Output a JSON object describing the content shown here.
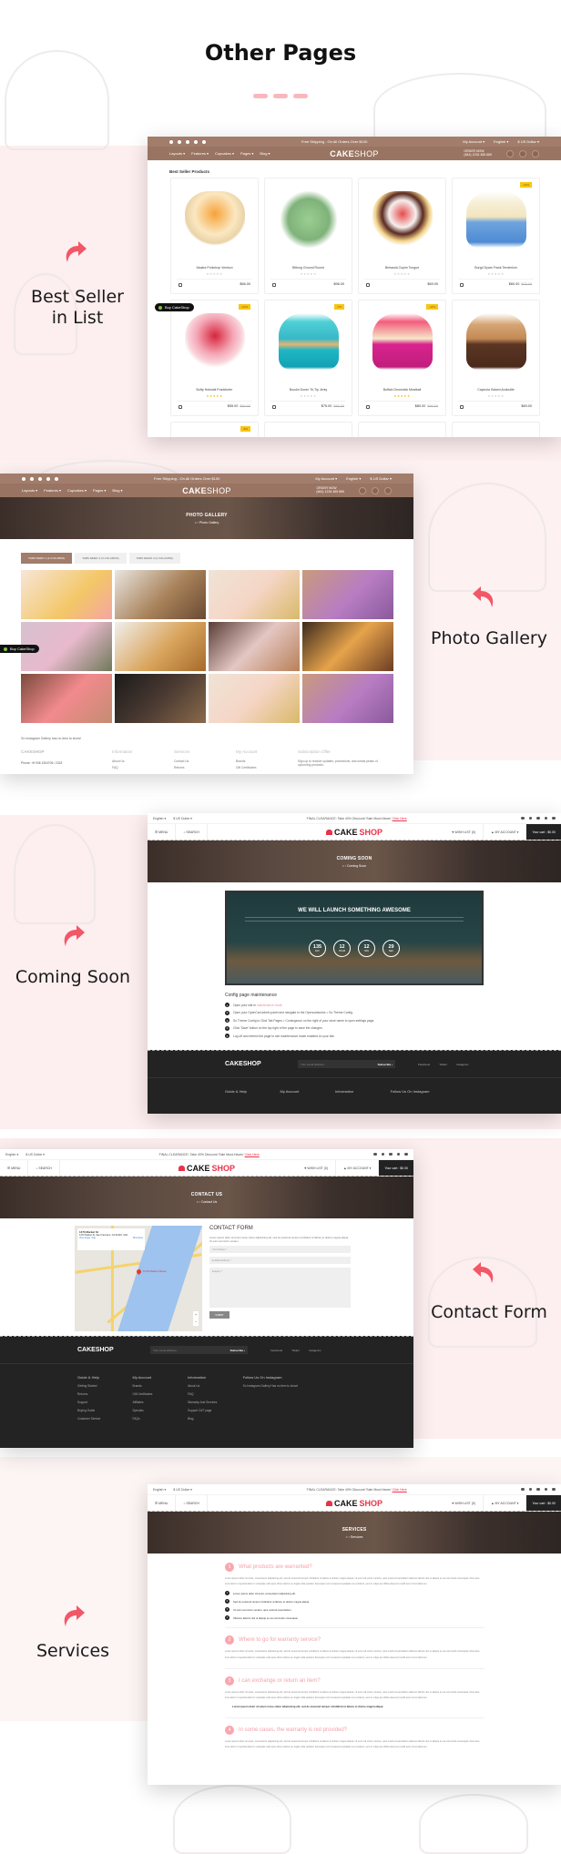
{
  "heading": "Other Pages",
  "labels": {
    "best_seller": "Best Seller\nin List",
    "best_seller_l1": "Best Seller",
    "best_seller_l2": "in List",
    "photo_gallery": "Photo Gallery",
    "coming_soon": "Coming Soon",
    "contact_form": "Contact Form",
    "services": "Services"
  },
  "icons": {
    "arrow": "curved-arrow-icon",
    "accent": "#f25767"
  },
  "brown_theme": {
    "top_bar_text": "Free Shipping - On All Orders Over $100",
    "my_account": "My Account ▾",
    "language": "English ▾",
    "currency": "$ US Dollar ▾",
    "nav": [
      "Layouts ▾",
      "Features ▾",
      "Cupcakes ▾",
      "Pages ▾",
      "Blog ▾"
    ],
    "logo_bold": "CAKE",
    "logo_thin": "SHOP",
    "order_label": "ORDER NOW",
    "phone": "(844) 1234 455 669",
    "cart_count": "0",
    "color": "#a27d6b"
  },
  "best_seller": {
    "title": "Best Seller Products",
    "badge": "Buy CakeShop",
    "products": [
      {
        "name": "Alcatra Porkchop Venison",
        "price": "$66.00",
        "old": "",
        "sale": "",
        "rated": false
      },
      {
        "name": "Biltong Ground Round",
        "price": "$96.00",
        "old": "",
        "sale": "",
        "rated": false
      },
      {
        "name": "Bresaola Cupim Tongue",
        "price": "$69.00",
        "old": "",
        "sale": "",
        "rated": false
      },
      {
        "name": "Burgd Dyam Frank Tenderloin",
        "price": "$60.00",
        "old": "$75.00",
        "sale": "-13%",
        "rated": false
      },
      {
        "name": "Boftp Hubwalt Frankfurter",
        "price": "$55.00",
        "old": "$60.00",
        "sale": "-10%",
        "rated": true
      },
      {
        "name": "Boudin Doner Tri-Tip Jerky",
        "price": "$75.00",
        "old": "$81.00",
        "sale": "-7%",
        "rated": false
      },
      {
        "name": "Buffalo Drumstick Meatball",
        "price": "$80.00",
        "old": "$90.00",
        "sale": "-11%",
        "rated": true
      },
      {
        "name": "Capicola Salami Andouille",
        "price": "$83.00",
        "old": "",
        "sale": "",
        "rated": false
      }
    ],
    "partial_row_sale": "-8%"
  },
  "photo_gallery": {
    "title": "PHOTO GALLERY",
    "breadcrumb": "Photo Gallery",
    "tabs": [
      "TABS DEMO 1 (4 COLUMNS)",
      "TABS DEMO 2 (3 COLUMNS)",
      "TABS DEMO 3 (2 COLUMNS)"
    ],
    "images": [
      "cupcakes-bear-toppers",
      "oat-cookies",
      "ice-cream-cup",
      "purple-smoothie-bowl",
      "pink-cafe-storefront",
      "apple-tart",
      "cupcake-display",
      "cake-slices-board",
      "pink-cupcakes-stand",
      "chocolate-bark",
      "ice-cream-cup",
      "purple-smoothie-bowl"
    ],
    "badge": "Buy CakeShop",
    "instagram_note": "So Instagram Gallery has no item to show!",
    "footer_logo": "CAKESHOP",
    "phone": "Phone: +8 936 1304705 / 2323",
    "columns": [
      {
        "title": "Information",
        "items": [
          "About Us",
          "FAQ"
        ]
      },
      {
        "title": "Services",
        "items": [
          "Contact Us",
          "Returns"
        ]
      },
      {
        "title": "My Account",
        "items": [
          "Brands",
          "Gift Certificates"
        ]
      }
    ],
    "subscription_title": "Subscription Offer",
    "subscription_text": "Sign up to receive updates, promotions, and sneak peaks of upcoming products."
  },
  "red_theme": {
    "language": "English ▾",
    "currency": "$ US Dollar ▾",
    "promo": "FINAL CLEARANCE: Take 40% Discount 'Sale Must-Haves'",
    "promo_link": "Click Here",
    "menu": "MENU",
    "search": "SEARCH",
    "logo_a": "CAKE",
    "logo_b": "SHOP",
    "wishlist": "WISH LIST (0)",
    "account": "MY ACCOUNT ▾",
    "cart": "Your cart : $0.00",
    "accent": "#e8334a"
  },
  "coming_soon": {
    "title": "COMING SOON",
    "breadcrumb": "Coming Soon",
    "headline": "WE WILL LAUNCH SOMETHING AWESOME",
    "countdown": [
      {
        "value": "135",
        "unit": "DAY"
      },
      {
        "value": "12",
        "unit": "HOUR"
      },
      {
        "value": "12",
        "unit": "MIN"
      },
      {
        "value": "29",
        "unit": "SEC"
      }
    ],
    "config_title": "Config page maintenance",
    "steps": [
      {
        "n": "1",
        "text": "Open your site in ",
        "link": "maintenance mode"
      },
      {
        "n": "2",
        "text": "Open your OpenCart admin panel and navigate to the Opencartworks > So Theme Config.",
        "link": ""
      },
      {
        "n": "3",
        "text": "So Theme Config to Click Tab Pages > Comingsoon on the right of your store name to open settings page.",
        "link": ""
      },
      {
        "n": "4",
        "text": "Click 'Save' button on the top right of the page to save the changes.",
        "link": ""
      },
      {
        "n": "5",
        "text": "Log off and refresh the page to see maintenance mode enabled on your site.",
        "link": ""
      }
    ]
  },
  "footer": {
    "logo": "CAKESHOP",
    "email_placeholder": "Your email address...",
    "subscribe": "Subscribe ›",
    "social": [
      "Facebook",
      "Twitter",
      "Instagram"
    ],
    "columns": [
      {
        "title": "Guide & Help",
        "items": [
          "Getting Started",
          "Returns",
          "Support",
          "Buying Guide",
          "Customer Service"
        ]
      },
      {
        "title": "My Account",
        "items": [
          "Brands",
          "Gift Certificates",
          "Affiliates",
          "Specials",
          "FAQs"
        ]
      },
      {
        "title": "Information",
        "items": [
          "About Us",
          "FAQ",
          "Warranty And Services",
          "Support 24/7 page",
          "Blog"
        ]
      },
      {
        "title": "Follow Us On Instagram",
        "items": [
          "So Instagram Gallery Has no item to show!"
        ]
      }
    ]
  },
  "contact": {
    "title": "CONTACT US",
    "breadcrumb": "Contact Us",
    "map_place": "1470 Market St",
    "map_address": "1470 Market St, San Francisco, CA 94103, USA",
    "map_directions": "Directions",
    "map_larger": "View larger map",
    "map_pin": "1470 Market Street",
    "form_title": "CONTACT FORM",
    "form_desc": "Lorem ipsum dolor sit amet conse ctetur adipisicing elit, sed do eiusmod tempor incididunt ut labore et dolore magna aliqua. Ut enim ad minim veniam.",
    "name_placeholder": "Your Name *",
    "email_placeholder": "E-Mail Address *",
    "enquiry_placeholder": "Enquiry *",
    "submit": "SUBMIT"
  },
  "services": {
    "title": "SERVICES",
    "breadcrumb": "Services",
    "faqs": [
      {
        "n": "1",
        "q": "What products are warranted?"
      },
      {
        "n": "2",
        "q": "Where to go for warranty service?"
      },
      {
        "n": "3",
        "q": "I can exchange or return an item?"
      },
      {
        "n": "4",
        "q": "In some cases, the warranty is not provided?"
      }
    ],
    "lorem": "Lorem ipsum dolor sit amet, consectetur adipisicing elit, sed do eiusmod tempor incididunt ut labore et dolore magna aliqua. Ut enim ad minim veniam, quis nostrud exercitation ullamco laboris nisi ut aliquip ex ea commodo consequat. Duis aute irure dolor in reprehenderit in voluptate velit esse cillum dolore eu fugiat nulla pariatur. Excepteur sint occaecat cupidatat non proident, sunt in culpa qui officia deserunt mollit anim id est laborum.",
    "list": [
      "Lorem ipsum dolor sit amet, consectetur adipisicing elit.",
      "Sed do eiusmod tempor incididunt ut labore et dolore magna aliqua.",
      "Ut enim ad minim veniam, quis nostrud exercitation.",
      "Ullamco laboris nisi ut aliquip ex ea commodo consequat."
    ],
    "quote": "Lorem ipsum dolor sit amet conse ctetur adipisicing elit, sed do eiusmod tempor incididunt ut labore et dolore magna aliqua."
  }
}
